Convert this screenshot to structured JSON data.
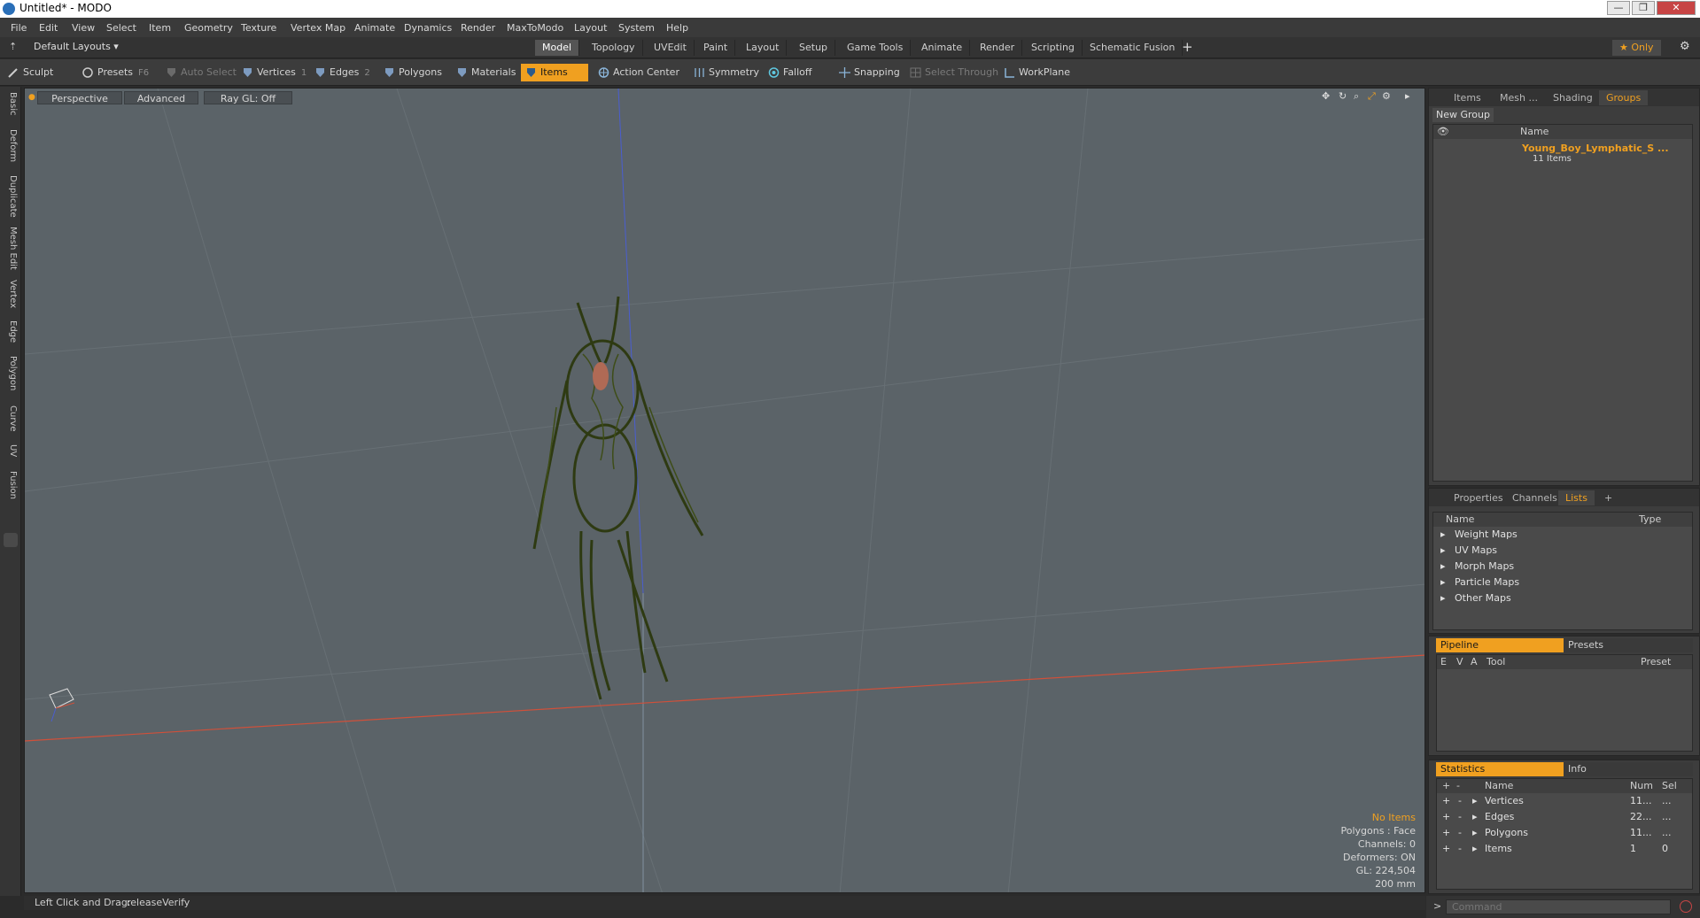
{
  "window": {
    "title": "Untitled* - MODO",
    "min": "—",
    "max": "❐",
    "close": "✕"
  },
  "menu": [
    "File",
    "Edit",
    "View",
    "Select",
    "Item",
    "Geometry",
    "Texture",
    "Vertex Map",
    "Animate",
    "Dynamics",
    "Render",
    "MaxToModo",
    "Layout",
    "System",
    "Help"
  ],
  "layout": {
    "selector": "Default Layouts ▾",
    "tabs": [
      "Model",
      "Topology",
      "UVEdit",
      "Paint",
      "Layout",
      "Setup",
      "Game Tools",
      "Animate",
      "Render",
      "Scripting",
      "Schematic Fusion"
    ],
    "add": "+",
    "only": "★ Only",
    "gear": "⚙"
  },
  "toolbar": {
    "sculpt": "Sculpt",
    "presets": "Presets",
    "presets_key": "F6",
    "auto_select": "Auto Select",
    "vertices": "Vertices",
    "vertices_key": "1",
    "edges": "Edges",
    "edges_key": "2",
    "polygons": "Polygons",
    "materials": "Materials",
    "items": "Items",
    "action_center": "Action Center",
    "symmetry": "Symmetry",
    "falloff": "Falloff",
    "snapping": "Snapping",
    "select_through": "Select Through",
    "workplane": "WorkPlane"
  },
  "left_tabs": [
    "Basic",
    "Deform",
    "Duplicate",
    "Mesh Edit",
    "Vertex",
    "Edge",
    "Polygon",
    "Curve",
    "UV",
    "Fusion"
  ],
  "viewport": {
    "perspective": "Perspective",
    "advanced": "Advanced",
    "raygl": "Ray GL: Off",
    "hud": {
      "no_items": "No Items",
      "polygons": "Polygons : Face",
      "channels": "Channels: 0",
      "deformers": "Deformers: ON",
      "gl": "GL: 224,504",
      "scale": "200 mm"
    },
    "colors": {
      "bg": "#5b6368",
      "grid": "#6a7378",
      "x_axis": "#d0503a",
      "y_axis": "#4a5ed0",
      "model": "#2e3a12"
    }
  },
  "status": {
    "label": "Left Click and Drag:",
    "value": "releaseVerify"
  },
  "groups_panel": {
    "tabs": [
      "Items",
      "Mesh ...",
      "Shading",
      "Groups"
    ],
    "new_group": "New Group",
    "col_name": "Name",
    "item_name": "Young_Boy_Lymphatic_S ...",
    "item_count": "11 Items"
  },
  "lists_panel": {
    "tabs": [
      "Properties",
      "Channels",
      "Lists",
      "+"
    ],
    "col_name": "Name",
    "col_type": "Type",
    "items": [
      "Weight Maps",
      "UV Maps",
      "Morph Maps",
      "Particle Maps",
      "Other Maps"
    ]
  },
  "pipeline_panel": {
    "tab_on": "Pipeline",
    "tab_off": "Presets",
    "cols": [
      "E",
      "V",
      "A",
      "Tool",
      "Preset"
    ]
  },
  "stats_panel": {
    "tab_on": "Statistics",
    "tab_off": "Info",
    "cols": [
      "+",
      "-",
      "Name",
      "Num",
      "Sel"
    ],
    "rows": [
      {
        "name": "Vertices",
        "num": "11...",
        "sel": "..."
      },
      {
        "name": "Edges",
        "num": "22...",
        "sel": "..."
      },
      {
        "name": "Polygons",
        "num": "11...",
        "sel": "..."
      },
      {
        "name": "Items",
        "num": "1",
        "sel": "0"
      }
    ]
  },
  "command": {
    "prompt": ">",
    "placeholder": "Command"
  }
}
